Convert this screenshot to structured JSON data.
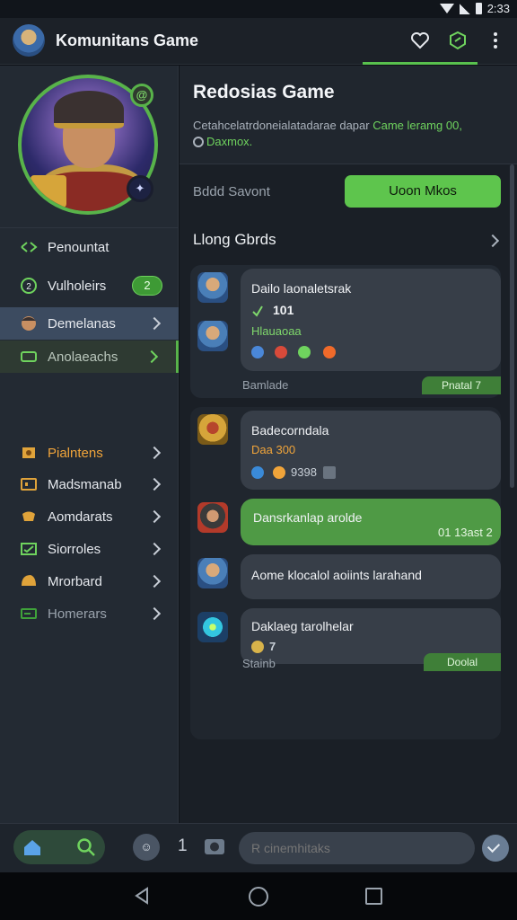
{
  "status_bar": {
    "time": "2:33"
  },
  "header": {
    "title": "Komunitans Game"
  },
  "sidebar": {
    "items": [
      {
        "label": "Penountat",
        "icon": "share-icon"
      },
      {
        "label": "Vulholeirs",
        "icon": "badge-icon",
        "count": "2"
      },
      {
        "label": "Demelanas",
        "icon": "avatar-icon"
      },
      {
        "label": "Anolaeachs",
        "icon": "ticket-icon"
      },
      {
        "label": "Pialntens",
        "icon": "puzzle-icon"
      },
      {
        "label": "Madsmanab",
        "icon": "box-icon"
      },
      {
        "label": "Aomdarats",
        "icon": "gamepad-icon"
      },
      {
        "label": "Siorroles",
        "icon": "mail-icon"
      },
      {
        "label": "Mrorbard",
        "icon": "helmet-icon"
      },
      {
        "label": "Homerars",
        "icon": "card-icon"
      }
    ]
  },
  "main": {
    "title": "Redosias Game",
    "desc_prefix": "Cetahcelatrdoneialatadarae dapar",
    "desc_highlight1": "Came leramg 00,",
    "desc_highlight2": "Daxmox.",
    "sort_label": "Bddd Savont",
    "primary_button": "Uoon Mkos",
    "section_title": "Llong Gbrds",
    "feed": [
      {
        "title": "Dailo laonaletsrak",
        "sub": "101",
        "sub2": "Hlauaoaa",
        "footer": "Bamlade",
        "chip": "Pnatal 7"
      },
      {
        "title": "Badecorndala",
        "sub": "Daa 300",
        "meta": "9398"
      },
      {
        "title": "Dansrkanlap arolde",
        "meta": "01 13ast 2"
      },
      {
        "title": "Aome klocalol aoiints larahand"
      },
      {
        "title": "Daklaeg tarolhelar",
        "meta": "7",
        "footer": "Stainb",
        "chip": "Doolal"
      }
    ]
  },
  "composer": {
    "counter": "1",
    "input_placeholder": "R cinemhitaks"
  },
  "colors": {
    "accent": "#5ec54d",
    "background": "#1a1f26",
    "sidebar": "#232a33"
  }
}
